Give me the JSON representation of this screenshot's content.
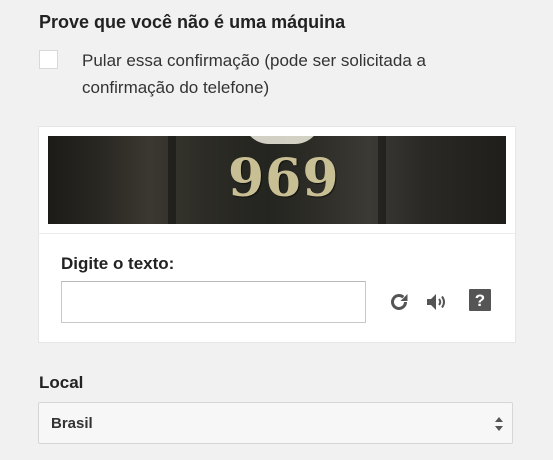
{
  "verification": {
    "heading": "Prove que você não é uma máquina",
    "skip_checkbox_checked": false,
    "skip_label": "Pular essa confirmação (pode ser solicitada a confirmação do telefone)"
  },
  "captcha": {
    "image_text": "969",
    "input_label": "Digite o texto:",
    "input_value": "",
    "icons": [
      "refresh-icon",
      "audio-icon",
      "help-icon"
    ]
  },
  "location": {
    "label": "Local",
    "selected": "Brasil"
  },
  "colors": {
    "background": "#f1f1f1",
    "card": "#ffffff",
    "icon": "#555555"
  }
}
